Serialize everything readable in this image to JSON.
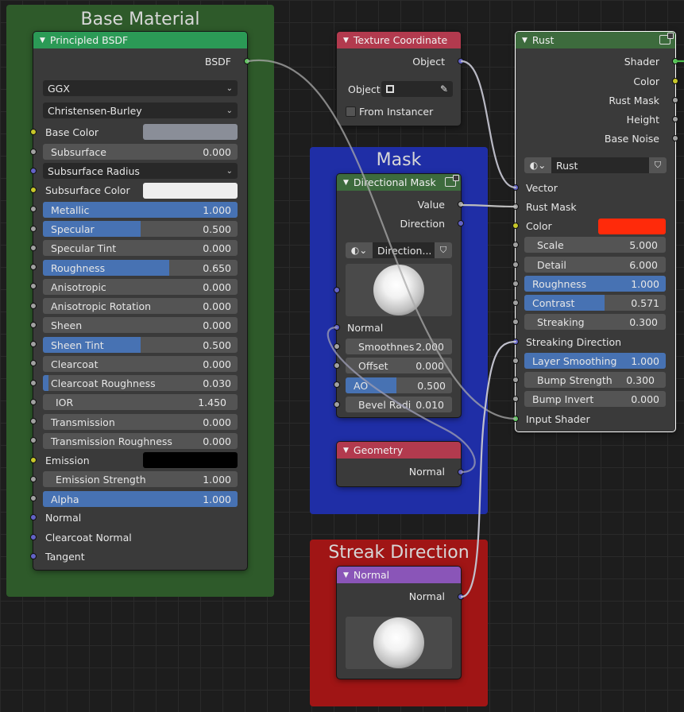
{
  "frames": {
    "base_material": "Base Material",
    "mask": "Mask",
    "streak_direction": "Streak Direction"
  },
  "principled": {
    "title": "Principled BSDF",
    "output": "BSDF",
    "distribution": "GGX",
    "subsurface_method": "Christensen-Burley",
    "base_color": "Base Color",
    "base_color_value": "#8a8e98",
    "subsurface": {
      "label": "Subsurface",
      "value": "0.000"
    },
    "subsurface_radius": "Subsurface Radius",
    "subsurface_color": "Subsurface Color",
    "subsurface_color_value": "#eeeeee",
    "metallic": {
      "label": "Metallic",
      "value": "1.000"
    },
    "specular": {
      "label": "Specular",
      "value": "0.500"
    },
    "specular_tint": {
      "label": "Specular Tint",
      "value": "0.000"
    },
    "roughness": {
      "label": "Roughness",
      "value": "0.650"
    },
    "anisotropic": {
      "label": "Anisotropic",
      "value": "0.000"
    },
    "anisotropic_rotation": {
      "label": "Anisotropic Rotation",
      "value": "0.000"
    },
    "sheen": {
      "label": "Sheen",
      "value": "0.000"
    },
    "sheen_tint": {
      "label": "Sheen Tint",
      "value": "0.500"
    },
    "clearcoat": {
      "label": "Clearcoat",
      "value": "0.000"
    },
    "clearcoat_roughness": {
      "label": "Clearcoat Roughness",
      "value": "0.030"
    },
    "ior": {
      "label": "IOR",
      "value": "1.450"
    },
    "transmission": {
      "label": "Transmission",
      "value": "0.000"
    },
    "transmission_roughness": {
      "label": "Transmission Roughness",
      "value": "0.000"
    },
    "emission": "Emission",
    "emission_value": "#000000",
    "emission_strength": {
      "label": "Emission Strength",
      "value": "1.000"
    },
    "alpha": {
      "label": "Alpha",
      "value": "1.000"
    },
    "normal": "Normal",
    "clearcoat_normal": "Clearcoat Normal",
    "tangent": "Tangent"
  },
  "texcoord": {
    "title": "Texture Coordinate",
    "output": "Object",
    "object_label": "Object:",
    "from_instancer": "From Instancer"
  },
  "dirmask": {
    "title": "Directional Mask",
    "value_out": "Value",
    "direction_out": "Direction",
    "group_name": "Direction...",
    "normal": "Normal",
    "smoothness": {
      "label": "Smoothnes",
      "value": "2.000"
    },
    "offset": {
      "label": "Offset",
      "value": "0.000"
    },
    "ao": {
      "label": "AO",
      "value": "0.500"
    },
    "bevel": {
      "label": "Bevel Radi",
      "value": "0.010"
    }
  },
  "geometry": {
    "title": "Geometry",
    "output": "Normal"
  },
  "normal_node": {
    "title": "Normal",
    "output": "Normal"
  },
  "rust": {
    "title": "Rust",
    "outputs": [
      "Shader",
      "Color",
      "Rust Mask",
      "Height",
      "Base Noise"
    ],
    "group_name": "Rust",
    "vector": "Vector",
    "rust_mask": "Rust Mask",
    "color": "Color",
    "color_value": "#ff2a0a",
    "scale": {
      "label": "Scale",
      "value": "5.000"
    },
    "detail": {
      "label": "Detail",
      "value": "6.000"
    },
    "roughness": {
      "label": "Roughness",
      "value": "1.000"
    },
    "contrast": {
      "label": "Contrast",
      "value": "0.571"
    },
    "streaking": {
      "label": "Streaking",
      "value": "0.300"
    },
    "streaking_direction": "Streaking Direction",
    "layer_smoothing": {
      "label": "Layer Smoothing",
      "value": "1.000"
    },
    "bump_strength": {
      "label": "Bump Strength",
      "value": "0.300"
    },
    "bump_invert": {
      "label": "Bump Invert",
      "value": "0.000"
    },
    "input_shader": "Input Shader"
  },
  "colors": {
    "header_shader": "#2b9a56",
    "header_input": "#b23a4e",
    "header_group": "#3d6b3d",
    "header_vector": "#8a55b8",
    "frame_green": "#2e5a2a",
    "frame_blue": "#1f2ea6",
    "frame_red": "#a01515",
    "accent_blue": "#4772b3"
  }
}
